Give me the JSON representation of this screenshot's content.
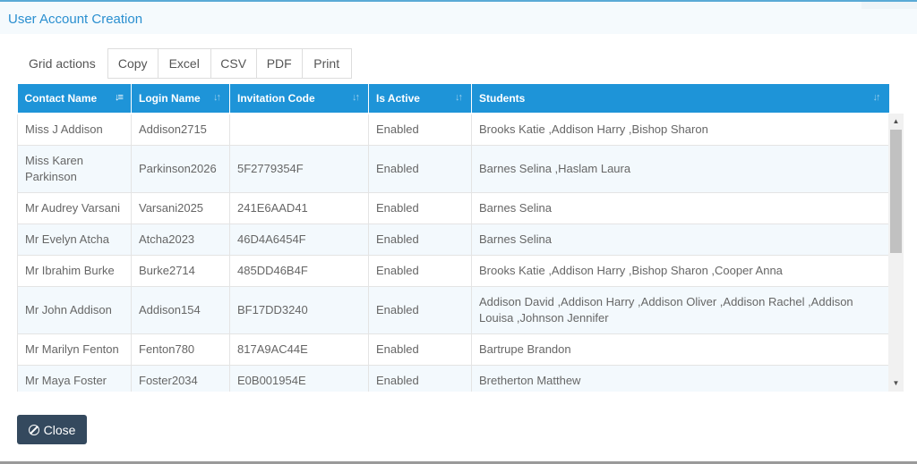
{
  "header": {
    "title": "User Account Creation"
  },
  "grid_actions": {
    "label": "Grid actions",
    "buttons": [
      "Copy",
      "Excel",
      "CSV",
      "PDF",
      "Print"
    ]
  },
  "table": {
    "columns": [
      "Contact Name",
      "Login Name",
      "Invitation Code",
      "Is Active",
      "Students"
    ],
    "rows": [
      [
        "Miss J Addison",
        "Addison2715",
        "",
        "Enabled",
        "Brooks Katie ,Addison Harry ,Bishop Sharon"
      ],
      [
        "Miss Karen Parkinson",
        "Parkinson2026",
        "5F2779354F",
        "Enabled",
        "Barnes Selina ,Haslam Laura"
      ],
      [
        "Mr Audrey Varsani",
        "Varsani2025",
        "241E6AAD41",
        "Enabled",
        "Barnes Selina"
      ],
      [
        "Mr Evelyn Atcha",
        "Atcha2023",
        "46D4A6454F",
        "Enabled",
        "Barnes Selina"
      ],
      [
        "Mr Ibrahim Burke",
        "Burke2714",
        "485DD46B4F",
        "Enabled",
        "Brooks Katie ,Addison Harry ,Bishop Sharon ,Cooper Anna"
      ],
      [
        "Mr John Addison",
        "Addison154",
        "BF17DD3240",
        "Enabled",
        "Addison David ,Addison Harry ,Addison Oliver ,Addison Rachel ,Addison Louisa ,Johnson Jennifer"
      ],
      [
        "Mr Marilyn Fenton",
        "Fenton780",
        "817A9AC44E",
        "Enabled",
        "Bartrupe Brandon"
      ],
      [
        "Mr Maya Foster",
        "Foster2034",
        "E0B001954E",
        "Enabled",
        "Bretherton Matthew"
      ]
    ]
  },
  "footer": {
    "close_label": "Close"
  },
  "icons": {
    "sort_active": "sort-alpha-icon",
    "sort": "sort-icon",
    "close": "ban-icon"
  },
  "colors": {
    "header_bg": "#1e94d8",
    "title": "#2a8fd0",
    "close_bg": "#34495e",
    "alt_row": "#f3f9fd"
  }
}
